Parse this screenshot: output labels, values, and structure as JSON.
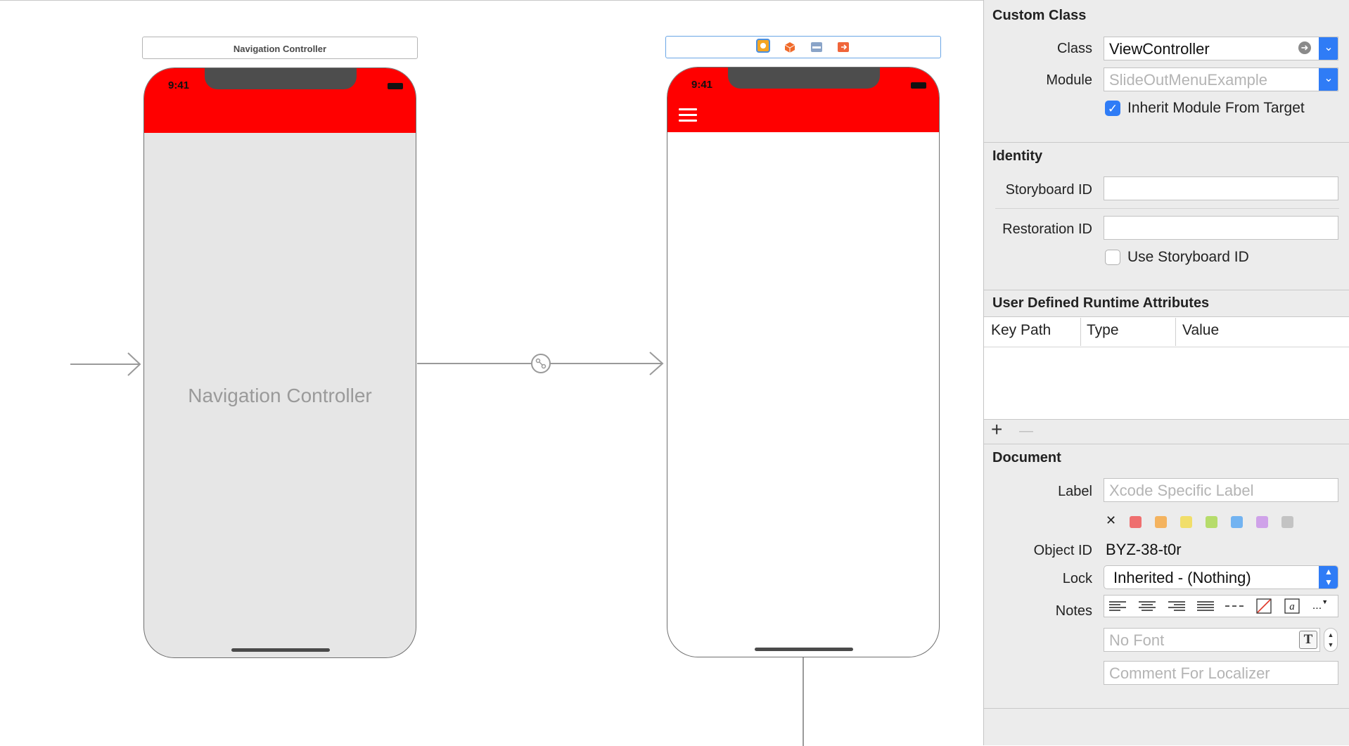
{
  "canvas": {
    "nav_scene_title": "Navigation Controller",
    "nav_phone": {
      "time": "9:41",
      "label": "Navigation Controller"
    },
    "vc_phone": {
      "time": "9:41"
    },
    "scene_dock_icons": [
      "view-controller-icon",
      "first-responder-icon",
      "scene-toolbar-icon",
      "exit-icon"
    ],
    "colors": {
      "status_bar": "#ff0000",
      "nav_body": "#e6e6e6",
      "vc_body": "#ffffff"
    }
  },
  "inspector": {
    "custom_class": {
      "title": "Custom Class",
      "class_label": "Class",
      "class_value": "ViewController",
      "module_label": "Module",
      "module_placeholder": "SlideOutMenuExample",
      "inherit_label": "Inherit Module From Target",
      "inherit_checked": true
    },
    "identity": {
      "title": "Identity",
      "storyboard_id_label": "Storyboard ID",
      "storyboard_id_value": "",
      "restoration_id_label": "Restoration ID",
      "restoration_id_value": "",
      "use_storyboard_label": "Use Storyboard ID",
      "use_storyboard_checked": false
    },
    "runtime_attributes": {
      "title": "User Defined Runtime Attributes",
      "columns": [
        "Key Path",
        "Type",
        "Value"
      ],
      "add": "+",
      "remove": "—"
    },
    "document": {
      "title": "Document",
      "label_label": "Label",
      "label_placeholder": "Xcode Specific Label",
      "clear_color": "✕",
      "label_colors": [
        "#ef6f6f",
        "#f4b35f",
        "#f1de6a",
        "#b6dc6b",
        "#72b3f1",
        "#cfa2e9",
        "#c3c3c3"
      ],
      "object_id_label": "Object ID",
      "object_id_value": "BYZ-38-t0r",
      "lock_label": "Lock",
      "lock_value": "Inherited - (Nothing)",
      "notes_label": "Notes",
      "notes_tools": [
        "align-left-icon",
        "align-center-icon",
        "align-right-icon",
        "align-justify-icon",
        "dash-icon",
        "no-color-icon",
        "text-color-icon",
        "more-icon"
      ],
      "font_placeholder": "No Font",
      "comment_placeholder": "Comment For Localizer",
      "more_label": "..."
    }
  }
}
